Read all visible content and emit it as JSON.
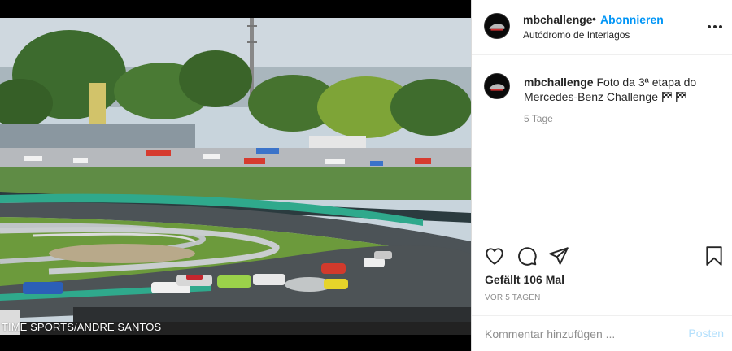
{
  "photo": {
    "credit": "TIME SPORTS/ANDRE SANTOS"
  },
  "header": {
    "username": "mbchallenge",
    "separator": "•",
    "follow_label": "Abonnieren",
    "location": "Autódromo de Interlagos",
    "more_icon": "more-horizontal-icon"
  },
  "caption": {
    "username": "mbchallenge",
    "text": "Foto da 3ª etapa do Mercedes-Benz Challenge",
    "emoji": [
      "checkered-flag-icon",
      "checkered-flag-icon"
    ],
    "time": "5 Tage"
  },
  "actions": {
    "icons": [
      "heart-icon",
      "comment-icon",
      "share-icon",
      "bookmark-icon"
    ],
    "likes": "Gefällt 106 Mal",
    "date": "VOR 5 TAGEN"
  },
  "comment": {
    "placeholder": "Kommentar hinzufügen ...",
    "post_label": "Posten"
  },
  "colors": {
    "accent": "#0095f6",
    "post_disabled": "#b2dffc",
    "text": "#262626",
    "secondary": "#8e8e8e"
  }
}
